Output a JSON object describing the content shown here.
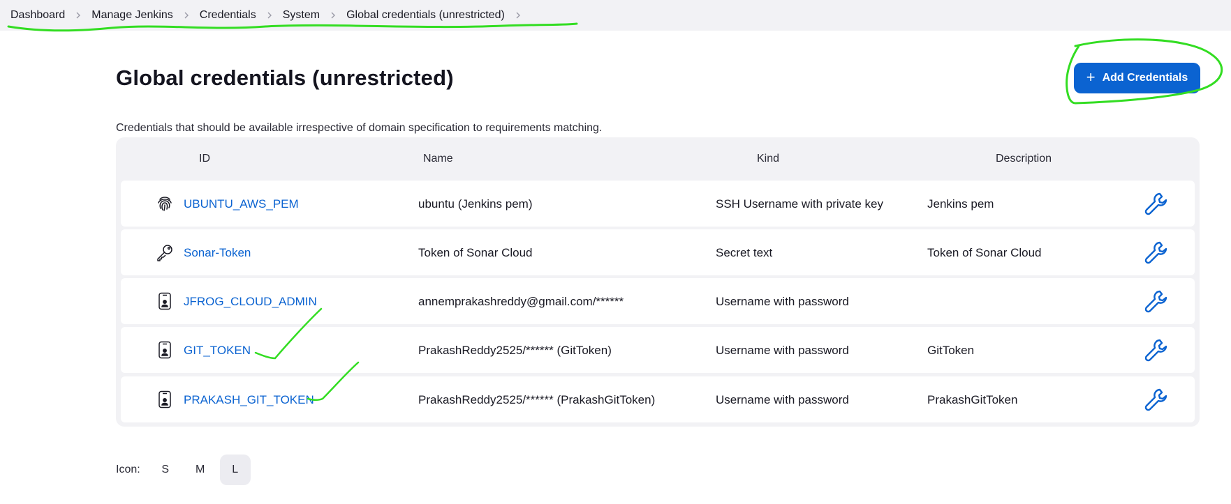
{
  "breadcrumb": [
    "Dashboard",
    "Manage Jenkins",
    "Credentials",
    "System",
    "Global credentials (unrestricted)"
  ],
  "page": {
    "title": "Global credentials (unrestricted)",
    "add_button": "Add Credentials",
    "description": "Credentials that should be available irrespective of domain specification to requirements matching."
  },
  "table": {
    "headers": {
      "id": "ID",
      "name": "Name",
      "kind": "Kind",
      "description": "Description"
    },
    "rows": [
      {
        "icon": "fingerprint-icon",
        "id": "UBUNTU_AWS_PEM",
        "name": "ubuntu (Jenkins pem)",
        "kind": "SSH Username with private key",
        "description": "Jenkins pem"
      },
      {
        "icon": "key-icon",
        "id": "Sonar-Token",
        "name": "Token of Sonar Cloud",
        "kind": "Secret text",
        "description": "Token of Sonar Cloud"
      },
      {
        "icon": "id-badge-icon",
        "id": "JFROG_CLOUD_ADMIN",
        "name": "annemprakashreddy@gmail.com/******",
        "kind": "Username with password",
        "description": ""
      },
      {
        "icon": "id-badge-icon",
        "id": "GIT_TOKEN",
        "name": "PrakashReddy2525/****** (GitToken)",
        "kind": "Username with password",
        "description": "GitToken"
      },
      {
        "icon": "id-badge-icon",
        "id": "PRAKASH_GIT_TOKEN",
        "name": "PrakashReddy2525/****** (PrakashGitToken)",
        "kind": "Username with password",
        "description": "PrakashGitToken"
      }
    ]
  },
  "icon_size": {
    "label": "Icon:",
    "options": [
      "S",
      "M",
      "L"
    ],
    "selected": "L"
  },
  "colors": {
    "accent": "#0b63d1",
    "annotation": "#33dd22",
    "background": "#f2f2f5"
  }
}
